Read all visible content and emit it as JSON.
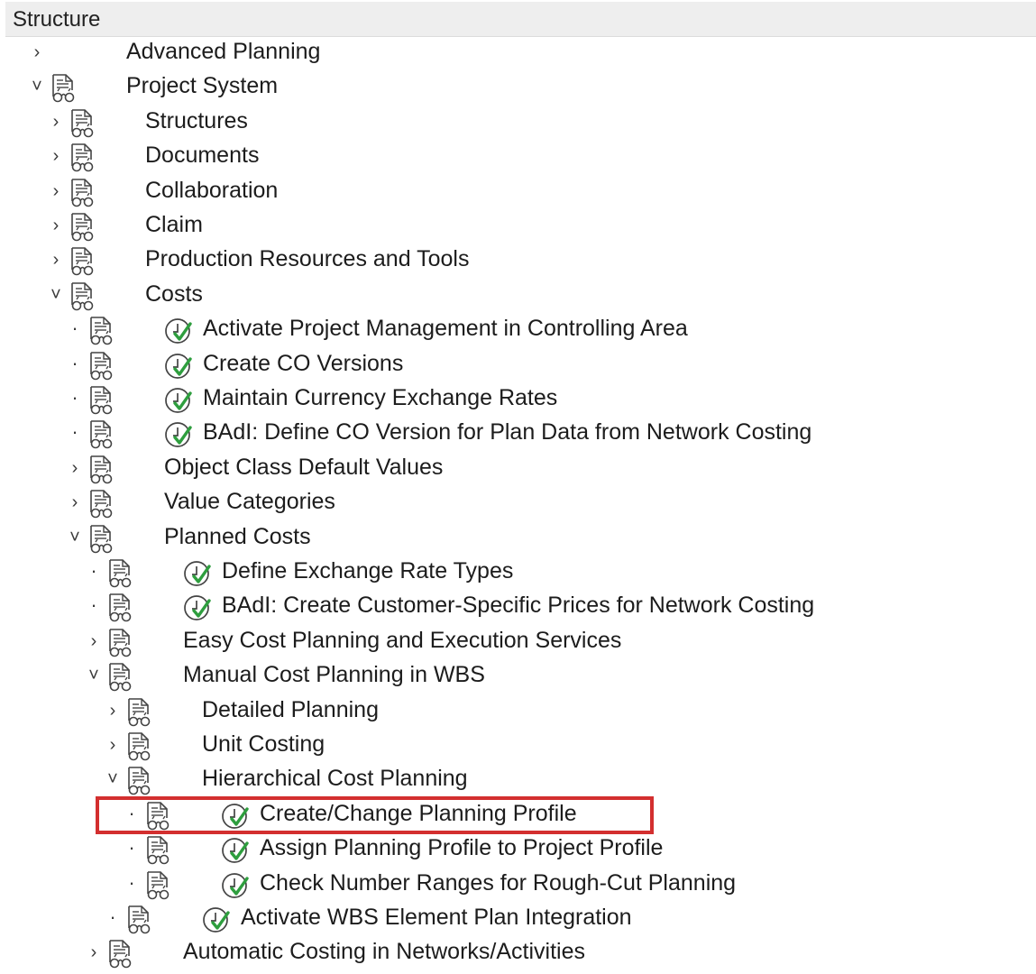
{
  "header": {
    "title": "Structure"
  },
  "colors": {
    "highlight": "#d32f2f",
    "check": "#2e9e3e",
    "icon_stroke": "#444444"
  },
  "icons": {
    "document": "document-binoculars-icon",
    "execute": "clock-check-execute-icon"
  },
  "tree": [
    {
      "label": "Advanced Planning",
      "level": 0,
      "state": "collapsed",
      "doc": false,
      "exec": false
    },
    {
      "label": "Project System",
      "level": 0,
      "state": "expanded",
      "doc": true,
      "exec": false
    },
    {
      "label": "Structures",
      "level": 1,
      "state": "collapsed",
      "doc": true,
      "exec": false
    },
    {
      "label": "Documents",
      "level": 1,
      "state": "collapsed",
      "doc": true,
      "exec": false
    },
    {
      "label": "Collaboration",
      "level": 1,
      "state": "collapsed",
      "doc": true,
      "exec": false
    },
    {
      "label": "Claim",
      "level": 1,
      "state": "collapsed",
      "doc": true,
      "exec": false
    },
    {
      "label": "Production Resources and Tools",
      "level": 1,
      "state": "collapsed",
      "doc": true,
      "exec": false
    },
    {
      "label": "Costs",
      "level": 1,
      "state": "expanded",
      "doc": true,
      "exec": false
    },
    {
      "label": "Activate Project Management in Controlling Area",
      "level": 2,
      "state": "leaf",
      "doc": true,
      "exec": true
    },
    {
      "label": "Create CO Versions",
      "level": 2,
      "state": "leaf",
      "doc": true,
      "exec": true
    },
    {
      "label": "Maintain Currency Exchange Rates",
      "level": 2,
      "state": "leaf",
      "doc": true,
      "exec": true
    },
    {
      "label": "BAdI: Define CO Version for Plan Data from Network Costing",
      "level": 2,
      "state": "leaf",
      "doc": true,
      "exec": true
    },
    {
      "label": "Object Class Default Values",
      "level": 2,
      "state": "collapsed",
      "doc": true,
      "exec": false
    },
    {
      "label": "Value Categories",
      "level": 2,
      "state": "collapsed",
      "doc": true,
      "exec": false
    },
    {
      "label": "Planned Costs",
      "level": 2,
      "state": "expanded",
      "doc": true,
      "exec": false
    },
    {
      "label": "Define Exchange Rate Types",
      "level": 3,
      "state": "leaf",
      "doc": true,
      "exec": true
    },
    {
      "label": "BAdI: Create Customer-Specific Prices for Network Costing",
      "level": 3,
      "state": "leaf",
      "doc": true,
      "exec": true
    },
    {
      "label": "Easy Cost Planning and Execution Services",
      "level": 3,
      "state": "collapsed",
      "doc": true,
      "exec": false
    },
    {
      "label": "Manual Cost Planning in WBS",
      "level": 3,
      "state": "expanded",
      "doc": true,
      "exec": false
    },
    {
      "label": "Detailed Planning",
      "level": 4,
      "state": "collapsed",
      "doc": true,
      "exec": false
    },
    {
      "label": "Unit Costing",
      "level": 4,
      "state": "collapsed",
      "doc": true,
      "exec": false
    },
    {
      "label": "Hierarchical Cost Planning",
      "level": 4,
      "state": "expanded",
      "doc": true,
      "exec": false
    },
    {
      "label": "Create/Change Planning Profile",
      "level": 5,
      "state": "leaf",
      "doc": true,
      "exec": true,
      "highlighted": true
    },
    {
      "label": "Assign Planning Profile to Project Profile",
      "level": 5,
      "state": "leaf",
      "doc": true,
      "exec": true
    },
    {
      "label": "Check Number Ranges for Rough-Cut Planning",
      "level": 5,
      "state": "leaf",
      "doc": true,
      "exec": true
    },
    {
      "label": "Activate WBS Element Plan Integration",
      "level": 4,
      "state": "leaf",
      "doc": true,
      "exec": true
    },
    {
      "label": "Automatic Costing in Networks/Activities",
      "level": 3,
      "state": "collapsed",
      "doc": true,
      "exec": false
    }
  ]
}
